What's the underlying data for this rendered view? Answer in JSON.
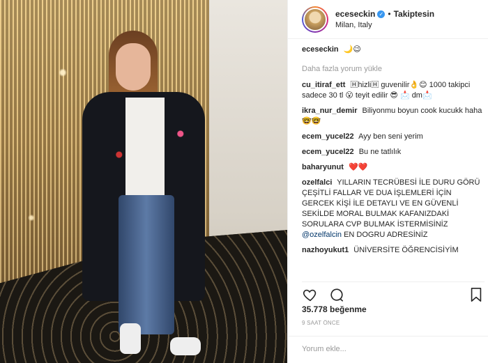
{
  "post": {
    "username": "eceseckin",
    "verified_icon": "✓",
    "separator": "•",
    "follow_status": "Takiptesin",
    "location": "Milan, Italy"
  },
  "caption": {
    "username": "eceseckin",
    "text": "🌙😉"
  },
  "load_more_label": "Daha fazla yorum yükle",
  "comments": [
    {
      "username": "cu_itiraf_ett",
      "text": "🄷hizli🄷 guvenilir👌😊 1000 takipci sadece 30 tl 😮 teyit edilir 😎 📩 dm📩"
    },
    {
      "username": "ikra_nur_demir",
      "text": "Biliyonmu boyun cook kucukk haha🤓🤓"
    },
    {
      "username": "ecem_yucel22",
      "text": "Ayy ben seni yerim"
    },
    {
      "username": "ecem_yucel22",
      "text": "Bu ne tatlılık"
    },
    {
      "username": "baharyunut",
      "text": "❤️❤️"
    },
    {
      "username": "ozelfalci",
      "text": "YILLARIN TECRÜBESİ İLE DURU GÖRÜ ÇEŞİTLİ FALLAR VE DUA İŞLEMLERİ İÇİN GERCEK KİŞİ İLE DETAYLI VE EN GÜVENLİ SEKİLDE MORAL BULMAK KAFANIZDAKİ SORULARA CVP BULMAK İSTERMİSİNİZ @ozelfalcin EN DOGRU ADRESİNİZ"
    },
    {
      "username": "nazhoyukut1",
      "text": "ÜNİVERSİTE ÖĞRENCİSİYİM"
    }
  ],
  "actions": {
    "like_icon": "heart-icon",
    "comment_icon": "comment-icon",
    "bookmark_icon": "bookmark-icon"
  },
  "likes_text": "35.778 beğenme",
  "timestamp": "9 SAAT ÖNCE",
  "add_comment_placeholder": "Yorum ekle...",
  "colors": {
    "link": "#003569",
    "verified": "#3897f0",
    "muted": "#999999",
    "text": "#262626"
  }
}
